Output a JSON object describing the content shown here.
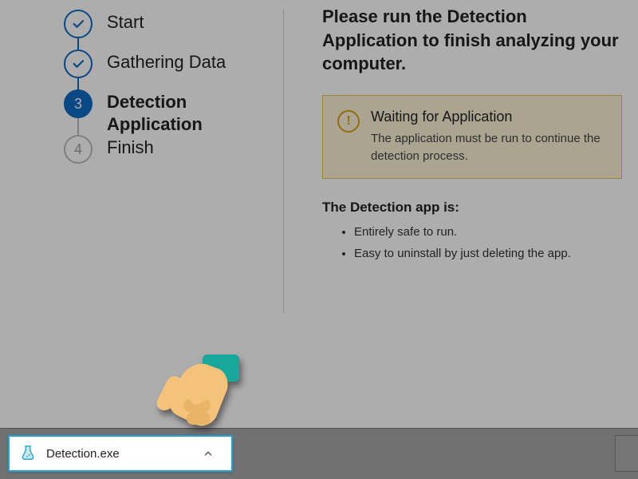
{
  "steps": [
    {
      "label": "Start",
      "state": "done"
    },
    {
      "label": "Gathering Data",
      "state": "done"
    },
    {
      "label": "Detection Application",
      "state": "active",
      "number": "3"
    },
    {
      "label": "Finish",
      "state": "todo",
      "number": "4"
    }
  ],
  "main": {
    "instruction": "Please run the Detection Application to finish analyzing your computer.",
    "alert": {
      "title": "Waiting for Application",
      "desc": "The application must be run to continue the detection process."
    },
    "sub_heading": "The Detection app is:",
    "bullets": [
      "Entirely safe to run.",
      "Easy to uninstall by just deleting the app."
    ]
  },
  "download": {
    "filename": "Detection.exe"
  }
}
